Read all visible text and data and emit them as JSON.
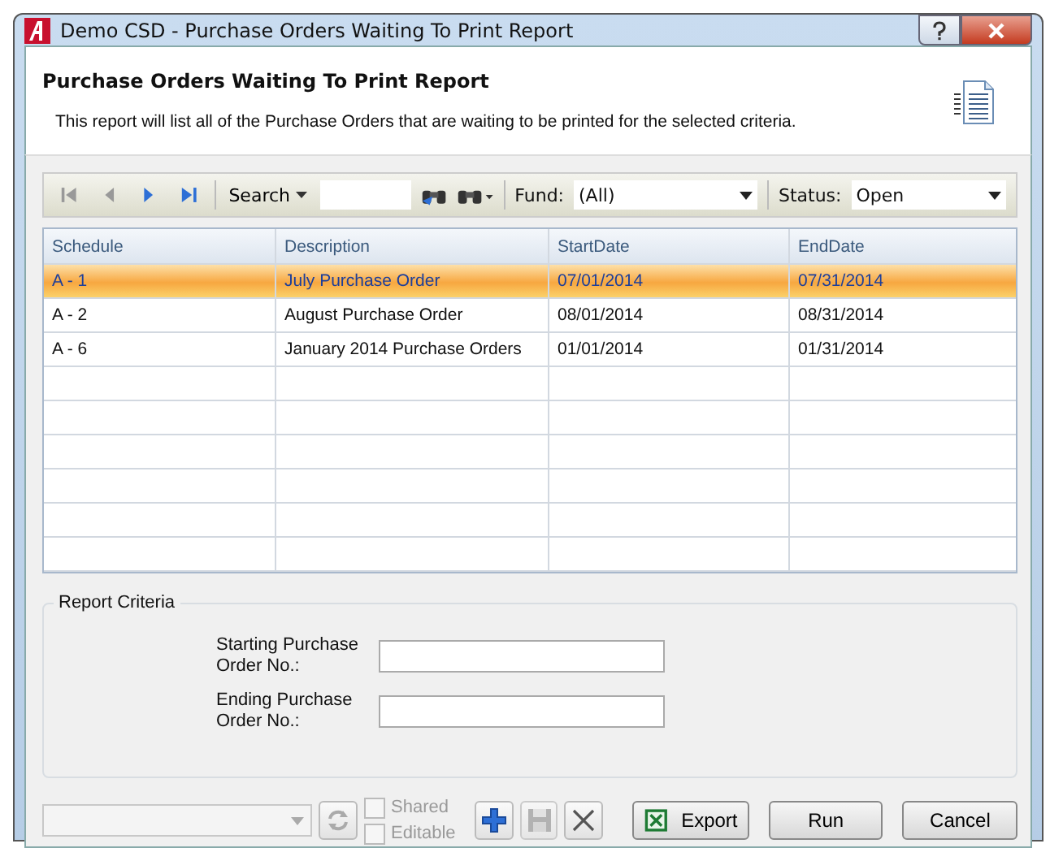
{
  "window": {
    "title": "Demo CSD - Purchase Orders Waiting To Print Report"
  },
  "header": {
    "title": "Purchase Orders Waiting To Print Report",
    "description": "This report will list all of the Purchase Orders that are waiting to be printed for the selected criteria."
  },
  "toolbar": {
    "search_label": "Search",
    "fund_label": "Fund:",
    "fund_value": "(All)",
    "status_label": "Status:",
    "status_value": "Open"
  },
  "table": {
    "columns": [
      "Schedule",
      "Description",
      "StartDate",
      "EndDate"
    ],
    "rows": [
      {
        "cells": [
          "A - 1",
          "July Purchase Order",
          "07/01/2014",
          "07/31/2014"
        ],
        "selected": true
      },
      {
        "cells": [
          "A - 2",
          "August Purchase Order",
          "08/01/2014",
          "08/31/2014"
        ],
        "selected": false
      },
      {
        "cells": [
          "A - 6",
          "January 2014 Purchase Orders",
          "01/01/2014",
          "01/31/2014"
        ],
        "selected": false
      }
    ]
  },
  "criteria": {
    "title": "Report Criteria",
    "fields": [
      {
        "label": "Starting Purchase Order No.:"
      },
      {
        "label": "Ending Purchase Order No.:"
      }
    ]
  },
  "footer": {
    "checkboxes": [
      {
        "label": "Shared",
        "checked": false,
        "disabled": true
      },
      {
        "label": "Editable",
        "checked": false,
        "disabled": true
      }
    ],
    "save_disabled": true,
    "delete_disabled": false,
    "buttons": [
      "Export",
      "Run",
      "Cancel"
    ]
  }
}
